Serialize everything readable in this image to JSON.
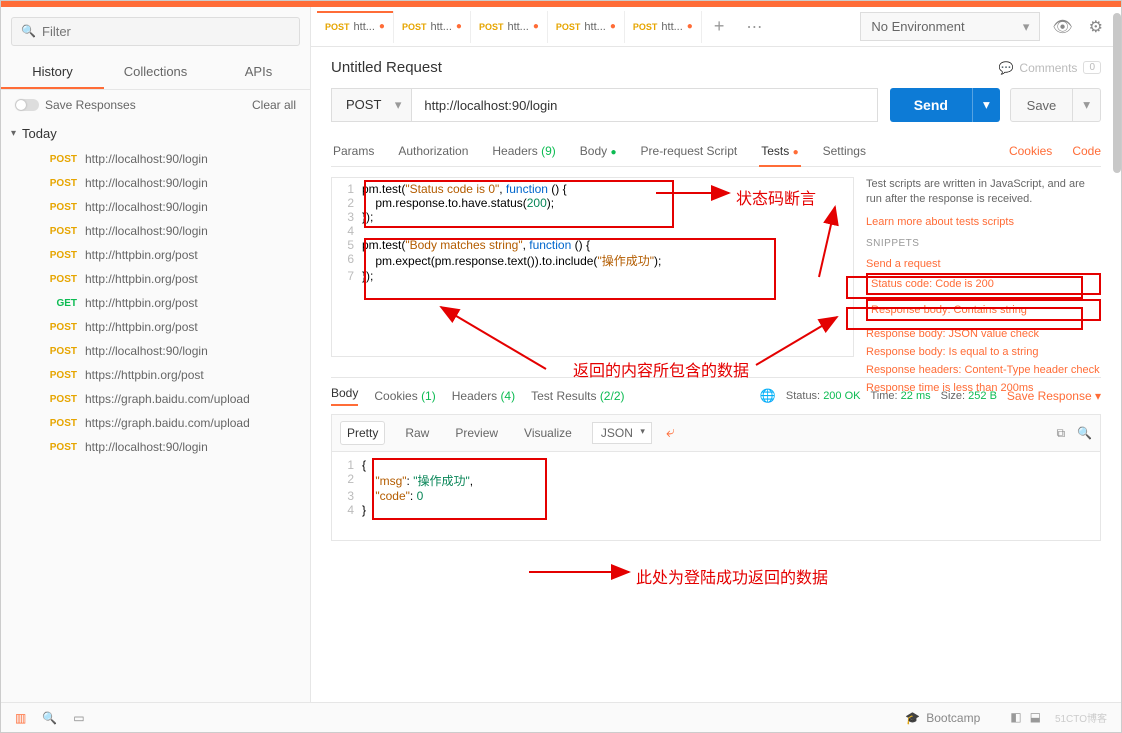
{
  "sidebar": {
    "filter_placeholder": "Filter",
    "tabs": [
      "History",
      "Collections",
      "APIs"
    ],
    "save_responses": "Save Responses",
    "clear_all": "Clear all",
    "today": "Today",
    "history": [
      {
        "method": "POST",
        "url": "http://localhost:90/login"
      },
      {
        "method": "POST",
        "url": "http://localhost:90/login"
      },
      {
        "method": "POST",
        "url": "http://localhost:90/login"
      },
      {
        "method": "POST",
        "url": "http://localhost:90/login"
      },
      {
        "method": "POST",
        "url": "http://httpbin.org/post"
      },
      {
        "method": "POST",
        "url": "http://httpbin.org/post"
      },
      {
        "method": "GET",
        "url": "http://httpbin.org/post"
      },
      {
        "method": "POST",
        "url": "http://httpbin.org/post"
      },
      {
        "method": "POST",
        "url": "http://localhost:90/login"
      },
      {
        "method": "POST",
        "url": "https://httpbin.org/post"
      },
      {
        "method": "POST",
        "url": "https://graph.baidu.com/upload"
      },
      {
        "method": "POST",
        "url": "https://graph.baidu.com/upload"
      },
      {
        "method": "POST",
        "url": "http://localhost:90/login"
      }
    ]
  },
  "tabs": [
    {
      "method": "POST",
      "label": "htt..."
    },
    {
      "method": "POST",
      "label": "htt..."
    },
    {
      "method": "POST",
      "label": "htt..."
    },
    {
      "method": "POST",
      "label": "htt..."
    },
    {
      "method": "POST",
      "label": "htt..."
    }
  ],
  "env": {
    "selected": "No Environment"
  },
  "request": {
    "title": "Untitled Request",
    "comments_label": "Comments",
    "comments_count": "0",
    "method": "POST",
    "url": "http://localhost:90/login",
    "send": "Send",
    "save": "Save",
    "tabs": {
      "params": "Params",
      "auth": "Authorization",
      "headers": "Headers",
      "headers_count": "(9)",
      "body": "Body",
      "prereq": "Pre-request Script",
      "tests": "Tests",
      "settings": "Settings",
      "cookies": "Cookies",
      "code": "Code"
    }
  },
  "tests_code": {
    "l1": "pm.test(\"Status code is 0\", function () {",
    "l2": "    pm.response.to.have.status(200);",
    "l3": "});",
    "l5": "pm.test(\"Body matches string\", function () {",
    "l6": "    pm.expect(pm.response.text()).to.include(\"操作成功\");",
    "l7": "});"
  },
  "snippets": {
    "desc": "Test scripts are written in JavaScript, and are run after the response is received.",
    "learn": "Learn more about tests scripts",
    "title": "SNIPPETS",
    "items": [
      "Send a request",
      "Status code: Code is 200",
      "Response body: Contains string",
      "Response body: JSON value check",
      "Response body: Is equal to a string",
      "Response headers: Content-Type header check",
      "Response time is less than 200ms"
    ]
  },
  "response": {
    "tabs": {
      "body": "Body",
      "cookies": "Cookies",
      "cookies_cnt": "(1)",
      "headers": "Headers",
      "headers_cnt": "(4)",
      "tests": "Test Results",
      "tests_cnt": "(2/2)"
    },
    "status_label": "Status:",
    "status_val": "200 OK",
    "time_label": "Time:",
    "time_val": "22 ms",
    "size_label": "Size:",
    "size_val": "252 B",
    "save_response": "Save Response",
    "toolbar": {
      "pretty": "Pretty",
      "raw": "Raw",
      "preview": "Preview",
      "visualize": "Visualize",
      "format": "JSON"
    },
    "body_json": {
      "msg_key": "\"msg\"",
      "msg_val": "\"操作成功\"",
      "code_key": "\"code\"",
      "code_val": "0"
    }
  },
  "annotations": {
    "status_assert": "状态码断言",
    "body_contains": "返回的内容所包含的数据",
    "login_success": "此处为登陆成功返回的数据"
  },
  "footer": {
    "bootcamp": "Bootcamp",
    "watermark": "51CTO博客"
  }
}
